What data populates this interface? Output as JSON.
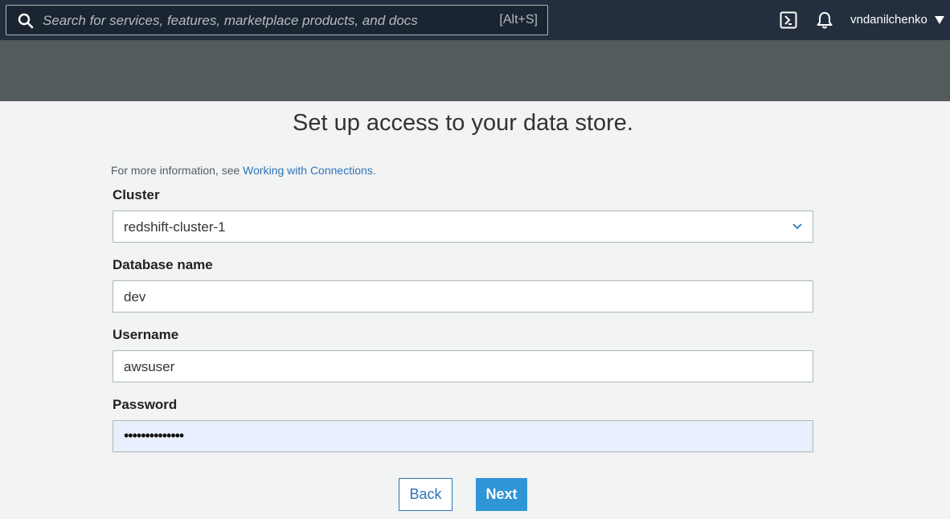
{
  "topbar": {
    "search_placeholder": "Search for services, features, marketplace products, and docs",
    "search_shortcut": "[Alt+S]",
    "icons": [
      "search-icon",
      "cloudshell-icon",
      "bell-icon",
      "caret-down-icon"
    ],
    "user": "vndanilchenko"
  },
  "page": {
    "title": "Set up access to your data store.",
    "info_prefix": "For more information, see ",
    "info_link": "Working with Connections."
  },
  "form": {
    "cluster": {
      "label": "Cluster",
      "value": "redshift-cluster-1"
    },
    "database": {
      "label": "Database name",
      "value": "dev"
    },
    "username": {
      "label": "Username",
      "value": "awsuser"
    },
    "password": {
      "label": "Password",
      "value": "••••••••••••••"
    }
  },
  "actions": {
    "back_label": "Back",
    "next_label": "Next"
  },
  "colors": {
    "topbar": "#232f3e",
    "band": "#545b5d",
    "background": "#f2f3f3",
    "link": "#2e73b8",
    "primary_button": "#2f95d5",
    "autofill": "#e8f0fe"
  }
}
